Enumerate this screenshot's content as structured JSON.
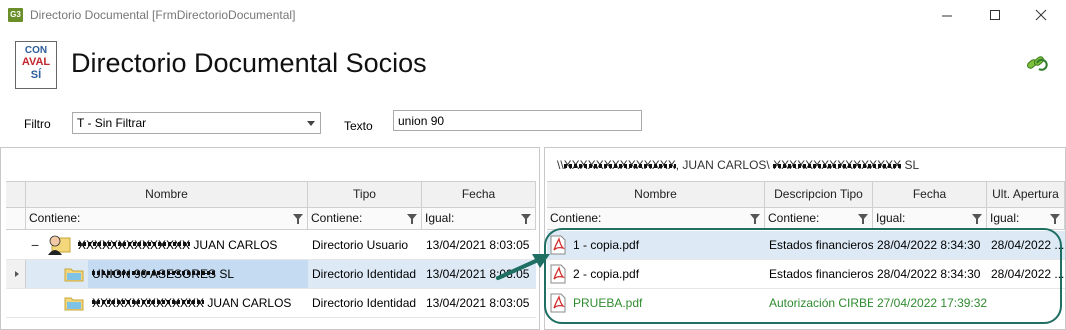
{
  "window": {
    "icon_text": "G3",
    "title": "Directorio Documental [FrmDirectorioDocumental]"
  },
  "header": {
    "logo_lines": [
      "CON",
      "AVAL",
      "SÍ"
    ],
    "title": "Directorio Documental Socios",
    "refresh_icon": "refresh-link-icon"
  },
  "filters": {
    "filtro_label": "Filtro",
    "filtro_value": "T - Sin Filtrar",
    "texto_label": "Texto",
    "texto_value": "union 90"
  },
  "left_grid": {
    "columns": [
      "Nombre",
      "Tipo",
      "Fecha"
    ],
    "filter_ops": [
      "Contiene:",
      "Contiene:",
      "Igual:"
    ],
    "rows": [
      {
        "nombre_redacted": "XXXXXXXXXXXXXX",
        "nombre_visible": "JUAN CARLOS",
        "tipo": "Directorio Usuario",
        "fecha": "13/04/2021 8:03:05",
        "icon": "user-folder-icon"
      },
      {
        "nombre_redacted": "UNION 90 ASESORES",
        "nombre_visible": "SL",
        "tipo": "Directorio Identidad",
        "fecha": "13/04/2021 8:03:05",
        "icon": "folder-icon"
      },
      {
        "nombre_redacted": "XXXXXXXXXXXXXX",
        "nombre_visible": "JUAN CARLOS",
        "tipo": "Directorio Identidad",
        "fecha": "13/04/2021 8:03:05",
        "icon": "folder-icon"
      }
    ]
  },
  "right_panel": {
    "path_prefix": "\\\\",
    "path_redacted_1": "XXXXXXXXXXXXXX",
    "path_visible_1": ", JUAN CARLOS\\ ",
    "path_redacted_2": "XXXXXXXXXXXXXXXX",
    "path_visible_2": " SL"
  },
  "right_grid": {
    "columns": [
      "Nombre",
      "Descripcion Tipo",
      "Fecha",
      "Ult. Apertura"
    ],
    "filter_ops": [
      "Contiene:",
      "Contiene:",
      "Igual:",
      "Igual:"
    ],
    "rows": [
      {
        "nombre": "1 - copia.pdf",
        "tipo": "Estados financieros",
        "fecha": "28/04/2022 8:34:30",
        "apertura": "28/04/2022 ..."
      },
      {
        "nombre": "2 - copia.pdf",
        "tipo": "Estados financieros",
        "fecha": "28/04/2022 8:34:30",
        "apertura": "28/04/2022 ..."
      },
      {
        "nombre": "PRUEBA.pdf",
        "tipo": "Autorización CIRBE...",
        "fecha": "27/04/2022 17:39:32",
        "apertura": ""
      }
    ]
  },
  "colors": {
    "selected_row": "#ddeaf6",
    "new_file_text": "#2f8b2f",
    "annotation": "#1f6f63"
  }
}
